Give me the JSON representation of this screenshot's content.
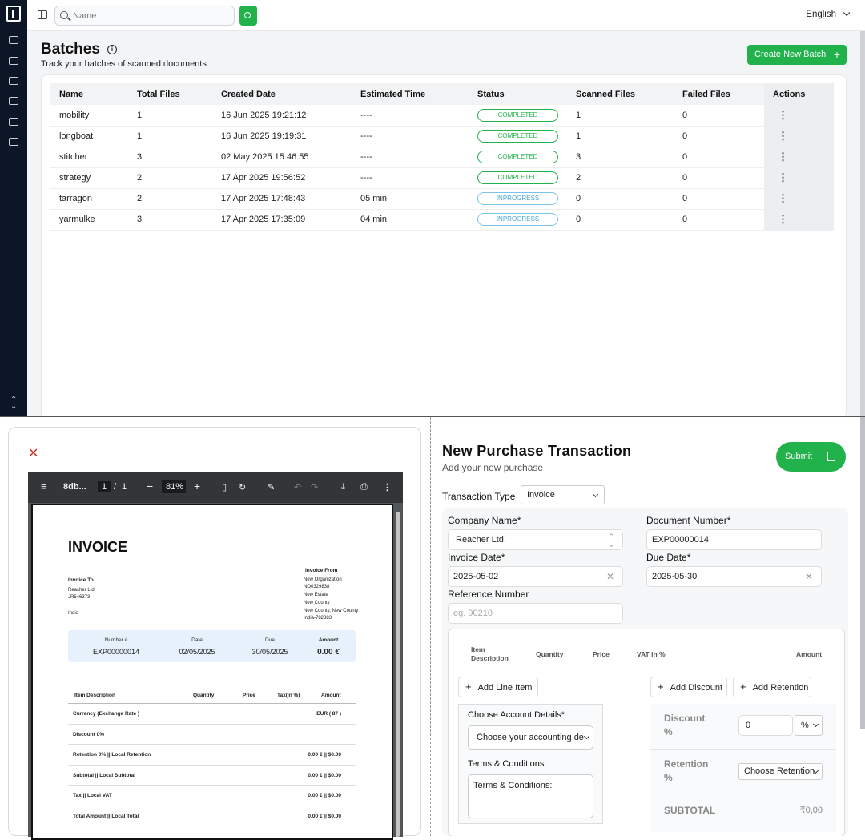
{
  "topbar": {
    "search_placeholder": "Name",
    "language": "English"
  },
  "batches": {
    "title": "Batches",
    "subtitle": "Track your batches of scanned documents",
    "create_label": "Create New Batch",
    "columns": [
      "Name",
      "Total Files",
      "Created Date",
      "Estimated Time",
      "Status",
      "Scanned Files",
      "Failed Files",
      "Actions"
    ],
    "rows": [
      {
        "name": "mobility",
        "total": "1",
        "created": "16 Jun 2025 19:21:12",
        "est": "----",
        "status": "COMPLETED",
        "scanned": "1",
        "failed": "0"
      },
      {
        "name": "longboat",
        "total": "1",
        "created": "16 Jun 2025 19:19:31",
        "est": "----",
        "status": "COMPLETED",
        "scanned": "1",
        "failed": "0"
      },
      {
        "name": "stitcher",
        "total": "3",
        "created": "02 May 2025 15:46:55",
        "est": "----",
        "status": "COMPLETED",
        "scanned": "3",
        "failed": "0"
      },
      {
        "name": "strategy",
        "total": "2",
        "created": "17 Apr 2025 19:56:52",
        "est": "----",
        "status": "COMPLETED",
        "scanned": "2",
        "failed": "0"
      },
      {
        "name": "tarragon",
        "total": "2",
        "created": "17 Apr 2025 17:48:43",
        "est": "05 min",
        "status": "INPROGRESS",
        "scanned": "0",
        "failed": "0"
      },
      {
        "name": "yarmulke",
        "total": "3",
        "created": "17 Apr 2025 17:35:09",
        "est": "04 min",
        "status": "INPROGRESS",
        "scanned": "0",
        "failed": "0"
      }
    ]
  },
  "pdf": {
    "filename": "8db...",
    "page": "1",
    "pages": "1",
    "zoom": "81%",
    "invoice": {
      "title": "INVOICE",
      "to_label": "Invoice To",
      "to_lines": [
        "Reacher Ltd.",
        "JR546373",
        "-",
        "India-"
      ],
      "from_label": "Invoice From",
      "from_lines": [
        "New Organization",
        "NO0329838",
        "New Estate",
        "New County",
        "New County, New County",
        "India-782383"
      ],
      "summary": [
        {
          "label": "Number #",
          "value": "EXP00000014"
        },
        {
          "label": "Date",
          "value": "02/05/2025"
        },
        {
          "label": "Due",
          "value": "30/05/2025"
        },
        {
          "label": "Amount",
          "value": "0.00 €"
        }
      ],
      "table_headers": [
        "Item Description",
        "Quantity",
        "Price",
        "Tax(in %)",
        "Amount"
      ],
      "table_rows": [
        {
          "label": "Currency (Exchange Rate )",
          "value": "EUR ( 87 )"
        },
        {
          "label": "Discount 0%",
          "value": ""
        },
        {
          "label": "Retention 0% || Local Retention",
          "value": "0.00 € || $0.00"
        },
        {
          "label": "Subtotal || Local Subtotal",
          "value": "0.00 € || $0.00"
        },
        {
          "label": "Tax || Local VAT",
          "value": "0.00 € || $0.00"
        },
        {
          "label": "Total Amount || Local Total",
          "value": "0.00 € || $0.00"
        }
      ]
    }
  },
  "purchase": {
    "title": "New Purchase Transaction",
    "subtitle": "Add your new purchase",
    "submit_label": "Submit",
    "transaction_type_label": "Transaction Type",
    "transaction_type": "Invoice",
    "company_label": "Company Name*",
    "company": "Reacher Ltd.",
    "doc_number_label": "Document Number*",
    "doc_number": "EXP00000014",
    "invoice_date_label": "Invoice Date*",
    "invoice_date": "2025-05-02",
    "due_date_label": "Due Date*",
    "due_date": "2025-05-30",
    "reference_label": "Reference Number",
    "reference_placeholder": "eg. 90210",
    "item_headers": {
      "desc": "Item Description",
      "qty": "Quantity",
      "price": "Price",
      "vat": "VAT in %",
      "amount": "Amount"
    },
    "add_line_label": "Add Line Item",
    "add_discount_label": "Add Discount",
    "add_retention_label": "Add Retention",
    "account_label": "Choose Account Details*",
    "account_placeholder": "Choose your accounting de",
    "terms_label": "Terms & Conditions:",
    "terms_value": "Terms & Conditions:",
    "discount_label": "Discount %",
    "discount_value": "0",
    "discount_unit": "%",
    "retention_label": "Retention %",
    "retention_placeholder": "Choose Retention",
    "subtotal_label": "SUBTOTAL",
    "subtotal_value": "₹0,00"
  }
}
